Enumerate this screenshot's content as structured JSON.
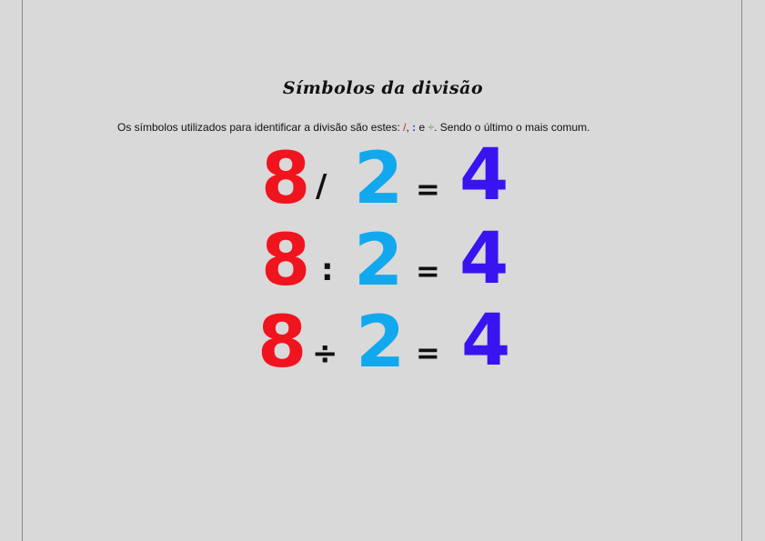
{
  "title": "Símbolos da divisão",
  "intro": {
    "before": "Os símbolos utilizados para identificar a divisão são estes: ",
    "symbol_slash": "/",
    "sep1": ", ",
    "symbol_colon": ":",
    "sep2": " e ",
    "symbol_div": "÷",
    "after": ". Sendo  o último o mais comum."
  },
  "examples": [
    {
      "dividend": "8",
      "operator": "/",
      "divisor": "2",
      "equals": "=",
      "result": "4"
    },
    {
      "dividend": "8",
      "operator": ":",
      "divisor": "2",
      "equals": "=",
      "result": "4"
    },
    {
      "dividend": "8",
      "operator": "÷",
      "divisor": "2",
      "equals": "=",
      "result": "4"
    }
  ],
  "colors": {
    "dividend": "#f0141e",
    "divisor": "#12a8ee",
    "result": "#3a14f0",
    "background": "#d9d9d9"
  }
}
